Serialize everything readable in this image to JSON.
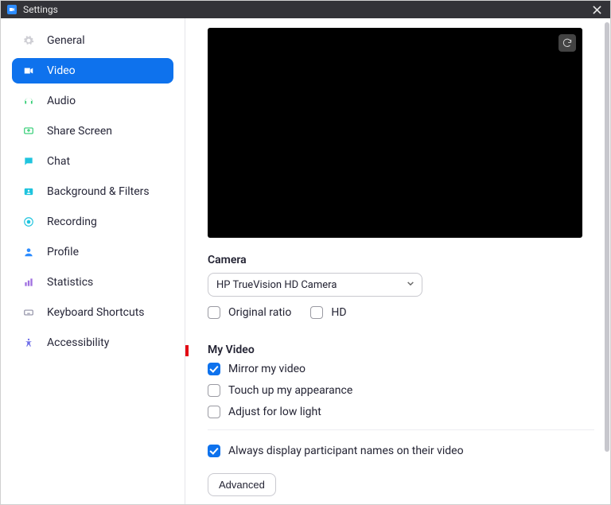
{
  "window": {
    "title": "Settings"
  },
  "sidebar": {
    "items": [
      {
        "label": "General",
        "icon": "gear",
        "clr": "#c9c9cf",
        "active": false
      },
      {
        "label": "Video",
        "icon": "video",
        "clr": "#ffffff",
        "active": true
      },
      {
        "label": "Audio",
        "icon": "headset",
        "clr": "#2ecc71",
        "active": false
      },
      {
        "label": "Share Screen",
        "icon": "screen",
        "clr": "#2ecc71",
        "active": false
      },
      {
        "label": "Chat",
        "icon": "chat",
        "clr": "#1fc4de",
        "active": false
      },
      {
        "label": "Background & Filters",
        "icon": "bg",
        "clr": "#1fc4de",
        "active": false
      },
      {
        "label": "Recording",
        "icon": "rec",
        "clr": "#1fc4de",
        "active": false
      },
      {
        "label": "Profile",
        "icon": "profile",
        "clr": "#2d8cff",
        "active": false
      },
      {
        "label": "Statistics",
        "icon": "stats",
        "clr": "#a070e0",
        "active": false
      },
      {
        "label": "Keyboard Shortcuts",
        "icon": "kbd",
        "clr": "#8f8fa5",
        "active": false
      },
      {
        "label": "Accessibility",
        "icon": "access",
        "clr": "#6d6de8",
        "active": false
      }
    ]
  },
  "camera": {
    "section_title": "Camera",
    "selected": "HP TrueVision HD Camera",
    "checks": [
      {
        "label": "Original ratio",
        "checked": false
      },
      {
        "label": "HD",
        "checked": false
      }
    ]
  },
  "my_video": {
    "section_title": "My Video",
    "checks": [
      {
        "label": "Mirror my video",
        "checked": true
      },
      {
        "label": "Touch up my appearance",
        "checked": false
      },
      {
        "label": "Adjust for low light",
        "checked": false
      }
    ]
  },
  "other": {
    "display_names": {
      "label": "Always display participant names on their video",
      "checked": true
    }
  },
  "advanced_label": "Advanced"
}
